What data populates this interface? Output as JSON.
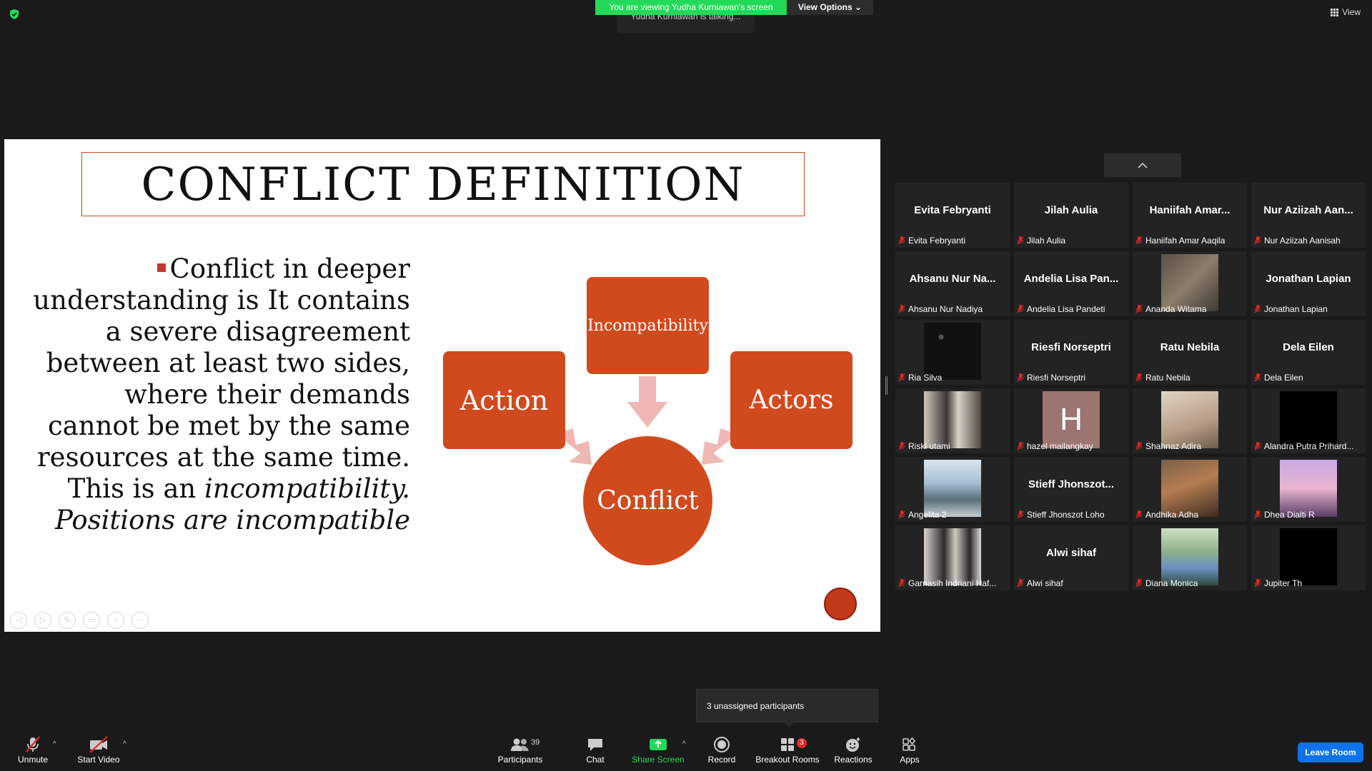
{
  "top": {
    "viewing_banner": "You are viewing Yudha Kurniawan's screen",
    "view_options": "View Options",
    "talking": "Yudha Kurniawan is talking...",
    "view": "View"
  },
  "slide": {
    "title": "CONFLICT DEFINITION",
    "body_line1": "Conflict in deeper understanding is It contains a severe disagreement between at least two sides, where their demands cannot be met by the same resources at the same time. This is an ",
    "body_italic1": "incompatibility.",
    "body_italic2": "Positions are incompatible",
    "node_incompat": "Incompatibility",
    "node_action": "Action",
    "node_actors": "Actors",
    "node_conflict": "Conflict"
  },
  "participants": [
    {
      "big": "Evita Febryanti",
      "name": "Evita Febryanti",
      "pic": ""
    },
    {
      "big": "Jilah Aulia",
      "name": "Jilah Aulia",
      "pic": ""
    },
    {
      "big": "Haniifah Amar...",
      "name": "Haniifah Amar Aaqila",
      "pic": ""
    },
    {
      "big": "Nur Aziizah Aan...",
      "name": "Nur Aziizah Aanisah",
      "pic": ""
    },
    {
      "big": "Ahsanu Nur Na...",
      "name": "Ahsanu Nur Nadiya",
      "pic": ""
    },
    {
      "big": "Andelia Lisa Pan...",
      "name": "Andelia Lisa Pandeti",
      "pic": ""
    },
    {
      "big": "",
      "name": "Ananda Witama",
      "pic": "books"
    },
    {
      "big": "Jonathan Lapian",
      "name": "Jonathan Lapian",
      "pic": ""
    },
    {
      "big": "",
      "name": "Ria Silva",
      "pic": "night"
    },
    {
      "big": "Riesfi Norseptri",
      "name": "Riesfi Norseptri",
      "pic": ""
    },
    {
      "big": "Ratu Nebila",
      "name": "Ratu Nebila",
      "pic": ""
    },
    {
      "big": "Dela Eilen",
      "name": "Dela Eilen",
      "pic": ""
    },
    {
      "big": "",
      "name": "Riski utami",
      "pic": "girls"
    },
    {
      "big": "",
      "name": "hazel mailangkay",
      "pic": "h"
    },
    {
      "big": "",
      "name": "Shahnaz Adira",
      "pic": "shahnaz"
    },
    {
      "big": "",
      "name": "Alandra Putra Prihard...",
      "pic": "black"
    },
    {
      "big": "",
      "name": "Angelita 2",
      "pic": "beach"
    },
    {
      "big": "Stieff Jhonszot...",
      "name": "Stieff Jhonszot Loho",
      "pic": ""
    },
    {
      "big": "",
      "name": "Andhika Adha",
      "pic": "selfie"
    },
    {
      "big": "",
      "name": "Dhea Dialti R",
      "pic": "flowers"
    },
    {
      "big": "",
      "name": "Garnasih Indriani Haf...",
      "pic": "two"
    },
    {
      "big": "Alwi sihaf",
      "name": "Alwi sihaf",
      "pic": ""
    },
    {
      "big": "",
      "name": "Diana Monica",
      "pic": "diana"
    },
    {
      "big": "",
      "name": "Jupiter Th",
      "pic": "black"
    }
  ],
  "hazel_initial": "H",
  "popup": "3 unassigned participants",
  "toolbar": {
    "unmute": "Unmute",
    "start_video": "Start Video",
    "participants": "Participants",
    "participants_count": "39",
    "chat": "Chat",
    "share_screen": "Share Screen",
    "record": "Record",
    "breakout_rooms": "Breakout Rooms",
    "breakout_badge": "3",
    "reactions": "Reactions",
    "apps": "Apps",
    "leave_room": "Leave Room"
  },
  "colors": {
    "accent_green": "#23d959",
    "node_orange": "#d14a1e",
    "leave_blue": "#0e72ed",
    "mute_red": "#e02828"
  }
}
